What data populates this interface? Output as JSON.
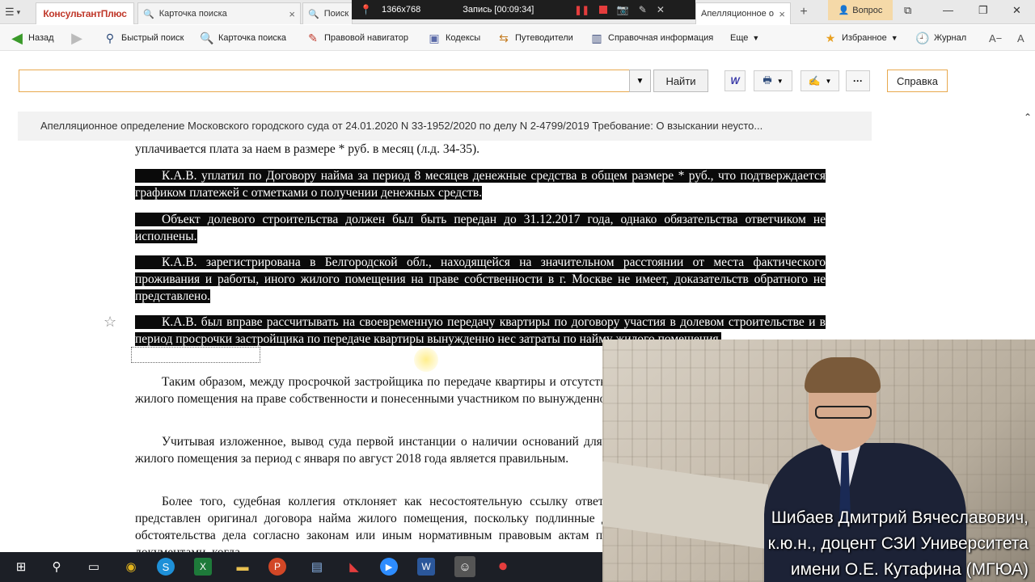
{
  "tabs": {
    "menu_icon": "hamburger-icon",
    "brand": "КонсультантПлюс",
    "tab1_label": "Карточка поиска",
    "tab2_label": "Поиск",
    "tab3_label": "Апелляционное определение",
    "close_glyph": "×",
    "new_tab_glyph": "+",
    "question_label": "Вопрос"
  },
  "recorder": {
    "resolution": "1366x768",
    "status": "Запись [00:09:34]"
  },
  "toolbar": {
    "back": "Назад",
    "quick_search": "Быстрый поиск",
    "search_card": "Карточка поиска",
    "legal_navigator": "Правовой навигатор",
    "codes": "Кодексы",
    "guides": "Путеводители",
    "reference": "Справочная информация",
    "more": "Еще",
    "favorites": "Избранное",
    "journal": "Журнал",
    "font_size": "A−"
  },
  "search": {
    "value": "",
    "find_label": "Найти",
    "help_label": "Справка"
  },
  "document": {
    "title": "Апелляционное определение Московского городского суда от 24.01.2020 N 33-1952/2020 по делу N 2-4799/2019 Требование: О взыскании неусто...",
    "p0": "уплачивается плата за наем в размере * руб. в месяц (л.д. 34-35).",
    "p1": "К.А.В. уплатил по Договору найма за период 8 месяцев денежные средства в общем размере * руб., что подтверждается графиком платежей с отметками о получении денежных средств.",
    "p2": "Объект долевого строительства должен был быть передан до 31.12.2017 года, однако обязательства ответчиком не исполнены.",
    "p3": "К.А.В. зарегистрирована в Белгородской обл., находящейся на значительном расстоянии от места фактического проживания и работы, иного жилого помещения на праве собственности в г. Москве не имеет, доказательств обратного не представлено.",
    "p4": "К.А.В. был вправе рассчитывать на своевременную передачу квартиры по договору участия в долевом строительстве и в период просрочки застройщика по передаче квартиры вынужденно нес затраты по найму жилого помещения.",
    "p5": "Таким образом, между просрочкой застройщика по передаче квартиры и отсутствием у участника долевого строительства жилого помещения на праве собственности и понесенными участником по вынужденному найму жилого помещения, имеется",
    "p6": "Учитывая изложенное, вывод суда первой инстанции о наличии оснований для взыскания с истцом расходов по найму жилого помещения за период с января по август 2018 года является правильным.",
    "p7": "Более того, судебная коллегия отклоняет как несостоятельную ссылку ответчика на то, что в материалы дела не представлен оригинал договора найма жилого помещения, поскольку подлинные документы представляются тогда, когда обстоятельства дела согласно законам или иным нормативным правовым актам подлежат подтверждению только такими документами, когда"
  },
  "webcam": {
    "caption_line1": "Шибаев Дмитрий Вячеславович,",
    "caption_line2": "к.ю.н., доцент СЗИ Университета",
    "caption_line3": "имени О.Е. Кутафина (МГЮА)"
  },
  "taskbar": {
    "icons": [
      "windows-start-icon",
      "search-icon",
      "task-view-icon",
      "chrome-icon",
      "skype-icon",
      "excel-icon",
      "explorer-icon",
      "powerpoint-icon",
      "notepad-icon",
      "acrobat-icon",
      "zoom-icon",
      "word-icon",
      "consultant-icon",
      "record-icon"
    ]
  },
  "colors": {
    "highlight_bg": "#0a0a0a",
    "highlight_text": "#ffffff",
    "accent_orange": "#e8a94f",
    "brand_red": "#c0392b",
    "recorder_red": "#e43d3d"
  }
}
